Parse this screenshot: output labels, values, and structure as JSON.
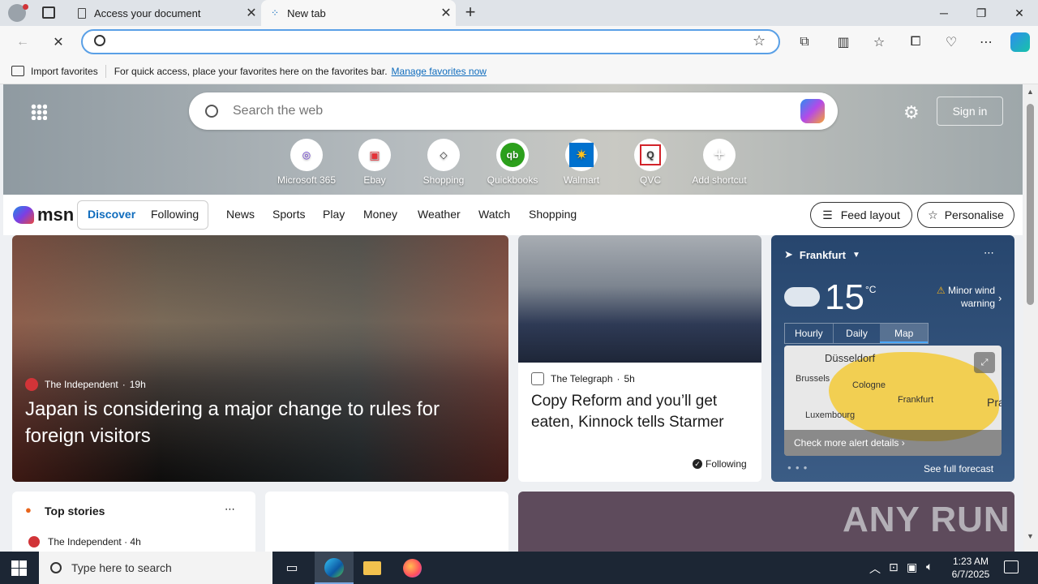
{
  "tabs": [
    {
      "label": "Access your document"
    },
    {
      "label": "New tab"
    }
  ],
  "address": {
    "value": "",
    "placeholder": ""
  },
  "favbar": {
    "import_label": "Import favorites",
    "hint": "For quick access, place your favorites here on the favorites bar.",
    "manage_link": "Manage favorites now"
  },
  "hero": {
    "search_placeholder": "Search the web",
    "signin": "Sign in",
    "shortcuts": [
      {
        "label": "Microsoft 365",
        "icon": "microsoft365-icon"
      },
      {
        "label": "Ebay",
        "icon": "ebay-icon"
      },
      {
        "label": "Shopping",
        "icon": "tag-icon"
      },
      {
        "label": "Quickbooks",
        "icon": "quickbooks-icon"
      },
      {
        "label": "Walmart",
        "icon": "walmart-icon"
      },
      {
        "label": "QVC",
        "icon": "qvc-icon"
      },
      {
        "label": "Add shortcut",
        "icon": "plus-icon"
      }
    ]
  },
  "nav": {
    "logo": "msn",
    "discover": "Discover",
    "following": "Following",
    "items": [
      "News",
      "Sports",
      "Play",
      "Money",
      "Weather",
      "Watch",
      "Shopping"
    ],
    "feed_layout": "Feed layout",
    "personalise": "Personalise"
  },
  "bigstory": {
    "source": "The Independent",
    "age": "19h",
    "headline": "Japan is considering a major change to rules for foreign visitors"
  },
  "midstory": {
    "source": "The Telegraph",
    "age": "5h",
    "headline": "Copy Reform and you’ll get eaten, Kinnock tells Starmer",
    "following": "Following"
  },
  "weather": {
    "city": "Frankfurt",
    "temp": "15",
    "unit": "°C",
    "warning": "Minor wind warning",
    "tabs": [
      "Hourly",
      "Daily",
      "Map"
    ],
    "map_labels": {
      "dusseldorf": "Düsseldorf",
      "brussels": "Brussels",
      "cologne": "Cologne",
      "frankfurt": "Frankfurt",
      "luxembourg": "Luxembourg",
      "prague": "Prag"
    },
    "alert_link": "Check more alert details",
    "forecast_link": "See full forecast"
  },
  "topstories": {
    "title": "Top stories",
    "source": "The Independent",
    "age": "4h"
  },
  "watermark": "ANY RUN",
  "taskbar": {
    "search_placeholder": "Type here to search",
    "time": "1:23 AM",
    "date": "6/7/2025"
  },
  "colors": {
    "accent": "#0f6cbd",
    "titlebar": "#dfe3e8",
    "taskbar": "#1c2634"
  }
}
